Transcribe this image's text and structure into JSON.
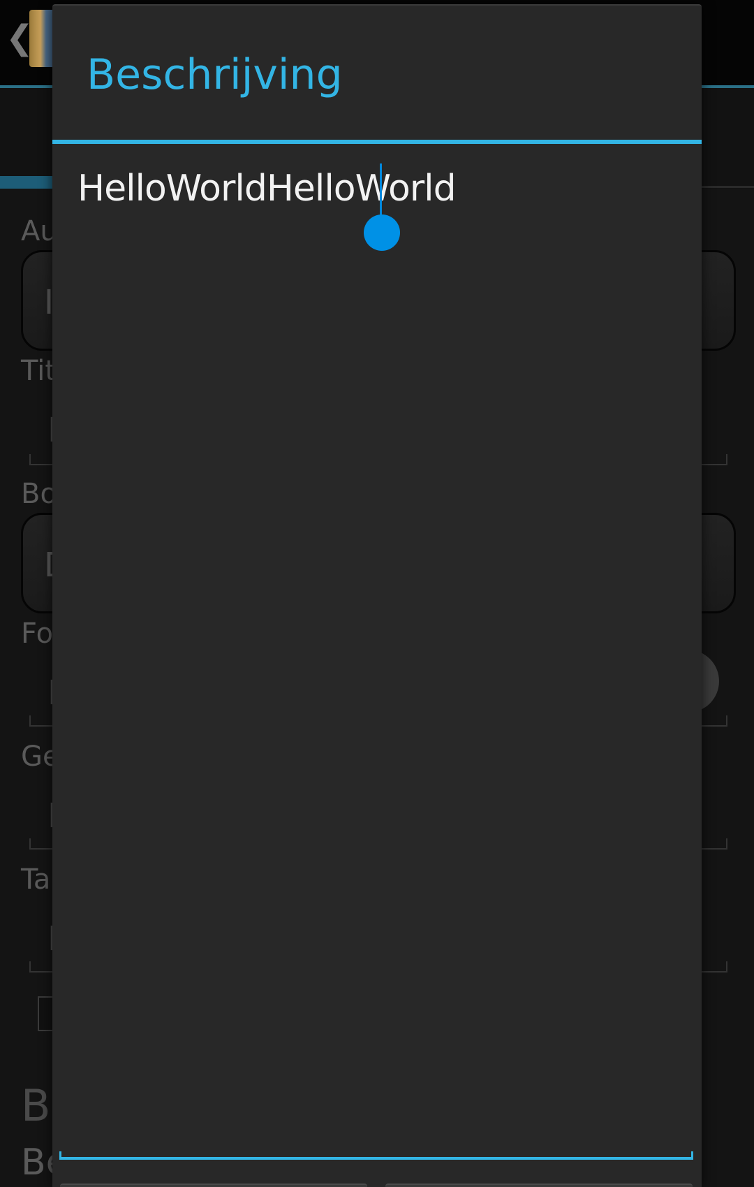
{
  "background": {
    "back_glyph": "❮",
    "app_icon": "book-icon",
    "labels": [
      {
        "id": "author",
        "text": "Au"
      },
      {
        "id": "title",
        "text": "Tit"
      },
      {
        "id": "book",
        "text": "Bo"
      },
      {
        "id": "format",
        "text": "Fo"
      },
      {
        "id": "genre",
        "text": "Ge"
      },
      {
        "id": "tags",
        "text": "Ta"
      }
    ],
    "field_letters": [
      "I",
      "I",
      "D",
      "I",
      "I",
      "I"
    ],
    "bottom_heading": "Be",
    "bottom_subheading": "Be"
  },
  "dialog": {
    "title": "Beschrijving",
    "edit_value": "HelloWorldHelloWorld",
    "accent_color": "#33b5e5",
    "cursor_color": "#0091e6"
  }
}
